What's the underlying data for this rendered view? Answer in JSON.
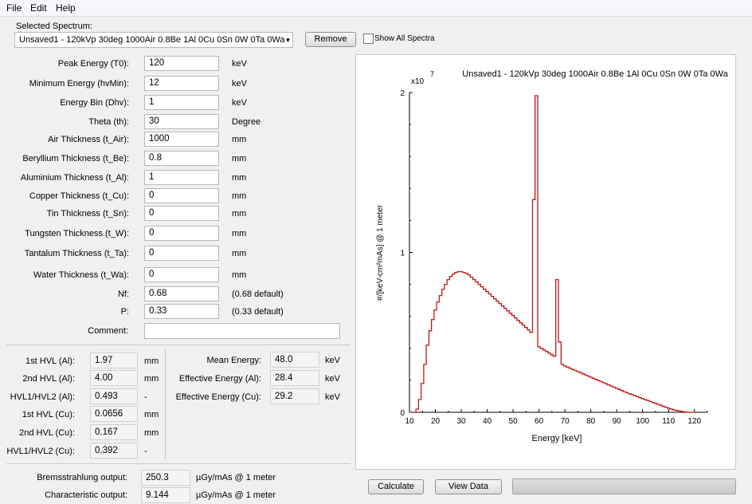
{
  "menu": [
    "File",
    "Edit",
    "Help"
  ],
  "selected_spectrum_label": "Selected Spectrum:",
  "selected_spectrum_value": "Unsaved1 - 120kVp 30deg 1000Air 0.8Be 1Al 0Cu 0Sn 0W 0Ta 0Wa",
  "remove_label": "Remove",
  "show_all_label": "Show All Spectra",
  "params": [
    {
      "label": "Peak Energy (T0):",
      "value": "120",
      "unit": "keV"
    },
    {
      "label": "Minimum Energy (hvMin):",
      "value": "12",
      "unit": "keV"
    },
    {
      "label": "Energy Bin (Dhv):",
      "value": "1",
      "unit": "keV"
    },
    {
      "label": "Theta (th):",
      "value": "30",
      "unit": "Degree"
    },
    {
      "label": "Air Thickness (t_Air):",
      "value": "1000",
      "unit": "mm"
    },
    {
      "label": "Beryllium Thickness (t_Be):",
      "value": "0.8",
      "unit": "mm"
    },
    {
      "label": "Aluminium Thickness (t_Al):",
      "value": "1",
      "unit": "mm"
    },
    {
      "label": "Copper Thickness (t_Cu):",
      "value": "0",
      "unit": "mm"
    },
    {
      "label": "Tin Thickness (t_Sn):",
      "value": "0",
      "unit": "mm"
    },
    {
      "label": "Tungsten Thickness (t_W):",
      "value": "0",
      "unit": "mm"
    },
    {
      "label": "Tantalum Thickness (t_Ta):",
      "value": "0",
      "unit": "mm"
    },
    {
      "label": "Water Thickness (t_Wa):",
      "value": "0",
      "unit": "mm"
    },
    {
      "label": "Nf:",
      "value": "0.68",
      "unit": "(0.68 default)"
    },
    {
      "label": "P:",
      "value": "0.33",
      "unit": "(0.33 default)"
    }
  ],
  "comment_label": "Comment:",
  "comment_value": "",
  "hvl": [
    {
      "label": "1st HVL (Al):",
      "value": "1.97",
      "unit": "mm"
    },
    {
      "label": "2nd HVL (Al):",
      "value": "4.00",
      "unit": "mm"
    },
    {
      "label": "HVL1/HVL2 (Al):",
      "value": "0.493",
      "unit": "-"
    },
    {
      "label": "1st HVL (Cu):",
      "value": "0.0656",
      "unit": "mm"
    },
    {
      "label": "2nd HVL (Cu):",
      "value": "0.167",
      "unit": "mm"
    },
    {
      "label": "HVL1/HVL2 (Cu):",
      "value": "0.392",
      "unit": "-"
    }
  ],
  "energies": [
    {
      "label": "Mean Energy:",
      "value": "48.0",
      "unit": "keV"
    },
    {
      "label": "Effective Energy (Al):",
      "value": "28.4",
      "unit": "keV"
    },
    {
      "label": "Effective Energy (Cu):",
      "value": "29.2",
      "unit": "keV"
    }
  ],
  "outputs": [
    {
      "label": "Bremsstrahlung output:",
      "value": "250.3",
      "unit": "µGy/mAs @ 1 meter"
    },
    {
      "label": "Characteristic output:",
      "value": "9.144",
      "unit": "µGy/mAs @ 1 meter"
    }
  ],
  "calculate_label": "Calculate",
  "view_data_label": "View Data",
  "progress": 0,
  "chart_data": {
    "type": "line",
    "title": "Unsaved1 - 120kVp 30deg 1000Air 0.8Be 1Al 0Cu 0Sn 0W 0Ta 0Wa",
    "xlabel": "Energy [keV]",
    "ylabel": "#/[keV-cm²mAs] @ 1 meter",
    "exponent_label": "x10",
    "exponent_value": "7",
    "xlim": [
      10,
      125
    ],
    "ylim": [
      0,
      2
    ],
    "xticks": [
      10,
      20,
      30,
      40,
      50,
      60,
      70,
      80,
      90,
      100,
      110,
      120
    ],
    "yticks": [
      0,
      1,
      2
    ],
    "line_color": "#c0161a",
    "series": [
      {
        "x": [
          12,
          13,
          14,
          15,
          16,
          17,
          18,
          19,
          20,
          21,
          22,
          23,
          24,
          25,
          26,
          27,
          28,
          29,
          30,
          31,
          32,
          33,
          34,
          35,
          36,
          37,
          38,
          39,
          40,
          41,
          42,
          43,
          44,
          45,
          46,
          47,
          48,
          49,
          50,
          51,
          52,
          53,
          54,
          55,
          56,
          57,
          58,
          59,
          60,
          61,
          62,
          63,
          64,
          65,
          66,
          67,
          68,
          69,
          70,
          71,
          72,
          73,
          74,
          75,
          76,
          77,
          78,
          79,
          80,
          81,
          82,
          83,
          84,
          85,
          86,
          87,
          88,
          89,
          90,
          91,
          92,
          93,
          94,
          95,
          96,
          97,
          98,
          99,
          100,
          101,
          102,
          103,
          104,
          105,
          106,
          107,
          108,
          109,
          110,
          111,
          112,
          113,
          114,
          115,
          116,
          117,
          118,
          119,
          120
        ],
        "y": [
          0.0,
          0.02,
          0.08,
          0.18,
          0.3,
          0.42,
          0.51,
          0.58,
          0.64,
          0.69,
          0.73,
          0.77,
          0.8,
          0.83,
          0.85,
          0.865,
          0.875,
          0.88,
          0.88,
          0.875,
          0.87,
          0.86,
          0.845,
          0.83,
          0.815,
          0.8,
          0.785,
          0.77,
          0.755,
          0.74,
          0.725,
          0.71,
          0.695,
          0.68,
          0.665,
          0.65,
          0.635,
          0.62,
          0.605,
          0.59,
          0.575,
          0.56,
          0.545,
          0.53,
          0.515,
          0.5,
          1.33,
          1.98,
          0.41,
          0.4,
          0.39,
          0.38,
          0.37,
          0.36,
          0.35,
          0.83,
          0.44,
          0.3,
          0.29,
          0.283,
          0.276,
          0.269,
          0.262,
          0.255,
          0.248,
          0.241,
          0.234,
          0.227,
          0.22,
          0.213,
          0.206,
          0.199,
          0.192,
          0.185,
          0.178,
          0.171,
          0.164,
          0.157,
          0.15,
          0.143,
          0.136,
          0.129,
          0.122,
          0.116,
          0.11,
          0.104,
          0.098,
          0.092,
          0.086,
          0.08,
          0.074,
          0.068,
          0.062,
          0.056,
          0.05,
          0.044,
          0.038,
          0.032,
          0.026,
          0.021,
          0.016,
          0.012,
          0.008,
          0.005,
          0.003,
          0.001,
          0.0,
          0.0,
          0.0
        ]
      }
    ]
  }
}
